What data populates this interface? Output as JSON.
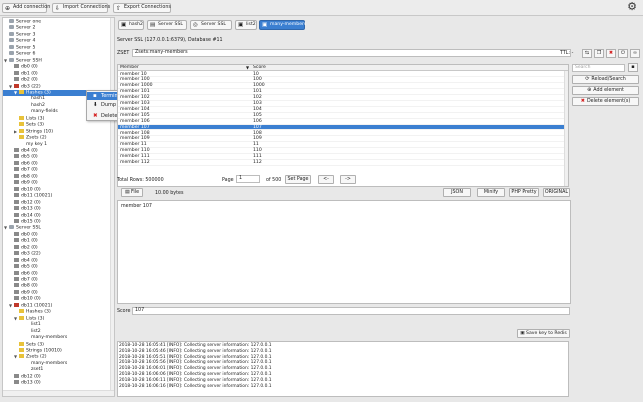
{
  "toolbar": {
    "add_connection": "Add connection",
    "import_connections": "Import Connections",
    "export_connections": "Export Connections"
  },
  "tree": [
    {
      "label": "Server one",
      "icon": "server",
      "depth": 0
    },
    {
      "label": "Server 2",
      "icon": "server",
      "depth": 0
    },
    {
      "label": "Server 3",
      "icon": "server",
      "depth": 0
    },
    {
      "label": "Server 4",
      "icon": "server",
      "depth": 0
    },
    {
      "label": "Server 5",
      "icon": "server",
      "depth": 0
    },
    {
      "label": "Server 6",
      "icon": "server",
      "depth": 0
    },
    {
      "label": "Server SSH",
      "icon": "server",
      "depth": 0,
      "arrow": "▼"
    },
    {
      "label": "db0 (0)",
      "icon": "db",
      "depth": 1
    },
    {
      "label": "db1 (0)",
      "icon": "db",
      "depth": 1
    },
    {
      "label": "db2 (0)",
      "icon": "db",
      "depth": 1
    },
    {
      "label": "db3 (22)",
      "icon": "db-open",
      "depth": 1,
      "arrow": "▼"
    },
    {
      "label": "Hashes (3)",
      "icon": "folder",
      "depth": 2,
      "arrow": "▼",
      "selected": true
    },
    {
      "label": "hash1",
      "icon": "none",
      "depth": 3
    },
    {
      "label": "hash2",
      "icon": "none",
      "depth": 3
    },
    {
      "label": "many-fields",
      "icon": "none",
      "depth": 3
    },
    {
      "label": "Lists (3)",
      "icon": "folder",
      "depth": 2
    },
    {
      "label": "Sets (3)",
      "icon": "folder",
      "depth": 2
    },
    {
      "label": "Strings (10)",
      "icon": "folder",
      "depth": 2,
      "arrow": "▶"
    },
    {
      "label": "Zsets (2)",
      "icon": "folder",
      "depth": 2
    },
    {
      "label": "my key 1",
      "icon": "none",
      "depth": 2
    },
    {
      "label": "db4 (0)",
      "icon": "db",
      "depth": 1
    },
    {
      "label": "db5 (0)",
      "icon": "db",
      "depth": 1
    },
    {
      "label": "db6 (0)",
      "icon": "db",
      "depth": 1
    },
    {
      "label": "db7 (0)",
      "icon": "db",
      "depth": 1
    },
    {
      "label": "db8 (0)",
      "icon": "db",
      "depth": 1
    },
    {
      "label": "db9 (0)",
      "icon": "db",
      "depth": 1
    },
    {
      "label": "db10 (0)",
      "icon": "db",
      "depth": 1
    },
    {
      "label": "db11 (10021)",
      "icon": "db",
      "depth": 1
    },
    {
      "label": "db12 (0)",
      "icon": "db",
      "depth": 1
    },
    {
      "label": "db13 (0)",
      "icon": "db",
      "depth": 1
    },
    {
      "label": "db14 (0)",
      "icon": "db",
      "depth": 1
    },
    {
      "label": "db15 (0)",
      "icon": "db",
      "depth": 1
    },
    {
      "label": "Server SSL",
      "icon": "server",
      "depth": 0,
      "arrow": "▼"
    },
    {
      "label": "db0 (0)",
      "icon": "db",
      "depth": 1
    },
    {
      "label": "db1 (0)",
      "icon": "db",
      "depth": 1
    },
    {
      "label": "db2 (0)",
      "icon": "db",
      "depth": 1
    },
    {
      "label": "db3 (22)",
      "icon": "db",
      "depth": 1
    },
    {
      "label": "db4 (0)",
      "icon": "db",
      "depth": 1
    },
    {
      "label": "db5 (0)",
      "icon": "db",
      "depth": 1
    },
    {
      "label": "db6 (0)",
      "icon": "db",
      "depth": 1
    },
    {
      "label": "db7 (0)",
      "icon": "db",
      "depth": 1
    },
    {
      "label": "db8 (0)",
      "icon": "db",
      "depth": 1
    },
    {
      "label": "db9 (0)",
      "icon": "db",
      "depth": 1
    },
    {
      "label": "db10 (0)",
      "icon": "db",
      "depth": 1
    },
    {
      "label": "db11 (10021)",
      "icon": "db-open",
      "depth": 1,
      "arrow": "▼"
    },
    {
      "label": "Hashes (3)",
      "icon": "folder",
      "depth": 2
    },
    {
      "label": "Lists (3)",
      "icon": "folder",
      "depth": 2,
      "arrow": "▼"
    },
    {
      "label": "list1",
      "icon": "none",
      "depth": 3
    },
    {
      "label": "list2",
      "icon": "none",
      "depth": 3
    },
    {
      "label": "many-members",
      "icon": "none",
      "depth": 3
    },
    {
      "label": "Sets (3)",
      "icon": "folder",
      "depth": 2
    },
    {
      "label": "Strings (10010)",
      "icon": "folder",
      "depth": 2
    },
    {
      "label": "Zsets (2)",
      "icon": "folder",
      "depth": 2,
      "arrow": "▼"
    },
    {
      "label": "many-members",
      "icon": "none",
      "depth": 3
    },
    {
      "label": "zset1",
      "icon": "none",
      "depth": 3
    },
    {
      "label": "db12 (0)",
      "icon": "db",
      "depth": 1
    },
    {
      "label": "db13 (0)",
      "icon": "db",
      "depth": 1
    }
  ],
  "context_menu": {
    "terminal": "Terminal",
    "dump": "Dump 'Hashes' to file",
    "delete": "Delete keys"
  },
  "tabs": [
    {
      "label": "hash2",
      "icon": "▣"
    },
    {
      "label": "Server SSL",
      "icon": "▤"
    },
    {
      "label": "Server SSL",
      "icon": "◎"
    },
    {
      "label": "list2",
      "icon": "▣"
    },
    {
      "label": "many-members",
      "icon": "▣",
      "active": true
    }
  ],
  "connection_info": "Server SSL (127.0.0.1:6379), Database #11",
  "key": {
    "type": "ZSET",
    "name": "Zsets:many-members",
    "ttl_label": "TTL: -"
  },
  "grid": {
    "col_member": "Member",
    "col_score": "Score",
    "rows": [
      {
        "member": "member 10",
        "score": "10"
      },
      {
        "member": "member 100",
        "score": "100"
      },
      {
        "member": "member 1000",
        "score": "1000"
      },
      {
        "member": "member 101",
        "score": "101"
      },
      {
        "member": "member 102",
        "score": "102"
      },
      {
        "member": "member 103",
        "score": "103"
      },
      {
        "member": "member 104",
        "score": "104"
      },
      {
        "member": "member 105",
        "score": "105"
      },
      {
        "member": "member 106",
        "score": "106"
      },
      {
        "member": "member 107",
        "score": "107",
        "selected": true
      },
      {
        "member": "member 108",
        "score": "108"
      },
      {
        "member": "member 109",
        "score": "109"
      },
      {
        "member": "member 11",
        "score": "11"
      },
      {
        "member": "member 110",
        "score": "110"
      },
      {
        "member": "member 111",
        "score": "111"
      },
      {
        "member": "member 112",
        "score": "112"
      }
    ]
  },
  "side": {
    "search_placeholder": "Search",
    "reload": "Reload/Search",
    "add": "Add element",
    "delete": "Delete element(s)"
  },
  "pager": {
    "total": "Total Rows: 500000",
    "page_label": "Page",
    "page_value": "1",
    "of": "of 500",
    "set_page": "Set Page",
    "prev": "<-",
    "next": "->"
  },
  "viewer": {
    "file_btn": "File",
    "size": "10.00 bytes",
    "json": "JSON",
    "minify": "Minify",
    "php": "PHP Pretty",
    "original": "ORIGINAL",
    "content": "member 107"
  },
  "score": {
    "label": "Score",
    "value": "107"
  },
  "save_btn": "Save key to Redis",
  "log": [
    "2018-10-28 16:05:41 [INFO]: Collecting server information: 127.0.0.1",
    "2018-10-28 16:05:46 [INFO]: Collecting server information: 127.0.0.1",
    "2018-10-28 16:05:51 [INFO]: Collecting server information: 127.0.0.1",
    "2018-10-28 16:05:56 [INFO]: Collecting server information: 127.0.0.1",
    "2018-10-28 16:06:01 [INFO]: Collecting server information: 127.0.0.1",
    "2018-10-28 16:06:06 [INFO]: Collecting server information: 127.0.0.1",
    "2018-10-28 16:06:11 [INFO]: Collecting server information: 127.0.0.1",
    "2018-10-28 16:06:16 [INFO]: Collecting server information: 127.0.0.1"
  ]
}
